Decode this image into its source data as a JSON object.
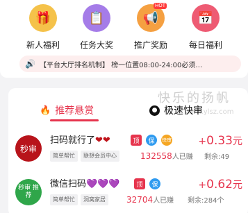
{
  "quick_links": [
    {
      "label": "新人福利",
      "icon": "gift-icon",
      "color": "#f5c24a",
      "glyph": "🎁"
    },
    {
      "label": "任务大奖",
      "icon": "clipboard-icon",
      "color": "#a57ce8",
      "glyph": "📋"
    },
    {
      "label": "推广奖励",
      "icon": "megaphone-icon",
      "color": "#f5a041",
      "glyph": "📢",
      "tag": "HOT"
    },
    {
      "label": "每日福利",
      "icon": "calendar-icon",
      "color": "#ee5b73",
      "glyph": "📅"
    }
  ],
  "notice": {
    "text": "【平台大厅排名机制】 榜一位置08:00-24:00必须…"
  },
  "tabs": {
    "recommended": "推荐悬赏",
    "fast": "极速快审"
  },
  "watermark": {
    "title": "快乐的扬帆",
    "url": "www.ylsz.com"
  },
  "tasks": [
    {
      "avatar_text": "秒审",
      "avatar_color": "#b8141b",
      "title": "扫码就行了",
      "hearts": "❤❤",
      "badges": {
        "top": "顶",
        "bao": "保",
        "fast": "快审"
      },
      "price_prefix": "+",
      "price": "0.33",
      "price_unit": "元",
      "category": "简单帮忙",
      "tag": "联想会员中心",
      "done_count": "132558",
      "done_label": "人已赚",
      "remaining": "剩余:49"
    },
    {
      "avatar_text": "秒审 推荐",
      "avatar_color": "#2fa64a",
      "title": "微信扫码",
      "hearts": "💜💜💜",
      "badges": {
        "top": "顶",
        "bao": "保"
      },
      "price_prefix": "+",
      "price": "0.62",
      "price_unit": "元",
      "category": "简单帮忙",
      "tag": "洞窝家居",
      "done_count": "32704",
      "done_label": "人已赚",
      "remaining": "剩余:284个"
    }
  ]
}
